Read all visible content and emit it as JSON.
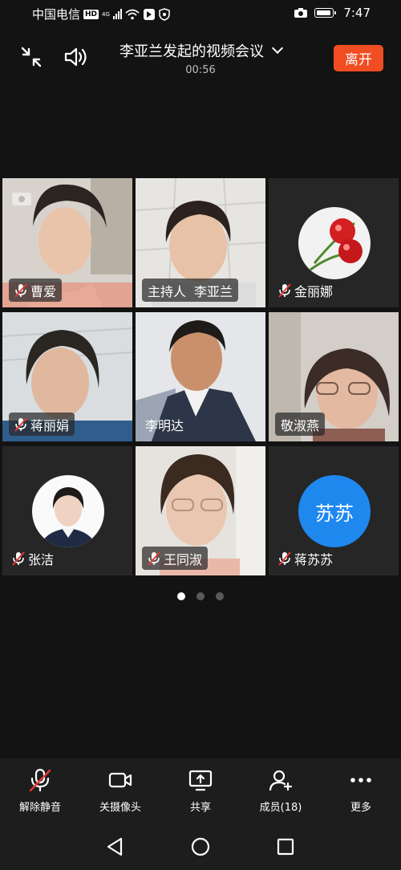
{
  "status_bar": {
    "carrier": "中国电信",
    "hd": "HD",
    "net_type": "4G",
    "time": "7:47"
  },
  "header": {
    "title": "李亚兰发起的视频会议",
    "elapsed": "00:56",
    "leave_label": "离开"
  },
  "participants": [
    {
      "name": "曹爱",
      "muted": true,
      "kind": "video"
    },
    {
      "name": "李亚兰",
      "host_label": "主持人",
      "muted": false,
      "kind": "video"
    },
    {
      "name": "金丽娜",
      "muted": true,
      "kind": "avatar-image",
      "avatar": "cherry-avatar"
    },
    {
      "name": "蒋丽娟",
      "muted": true,
      "kind": "video"
    },
    {
      "name": "李明达",
      "muted": false,
      "kind": "video"
    },
    {
      "name": "敬淑燕",
      "muted": false,
      "kind": "video"
    },
    {
      "name": "张洁",
      "muted": true,
      "kind": "avatar-image",
      "avatar": "portrait-avatar"
    },
    {
      "name": "王同淑",
      "muted": true,
      "kind": "video"
    },
    {
      "name": "蒋苏苏",
      "muted": true,
      "kind": "avatar-text",
      "avatar_text": "苏苏"
    }
  ],
  "pager": {
    "pages": 3,
    "current": 1
  },
  "toolbar": {
    "unmute_label": "解除静音",
    "camera_off_label": "关摄像头",
    "share_label": "共享",
    "members_label": "成员(18)",
    "more_label": "更多"
  },
  "colors": {
    "leave_button": "#f04d23",
    "avatar_blue": "#1e88ef",
    "mute_red": "#e53935"
  }
}
